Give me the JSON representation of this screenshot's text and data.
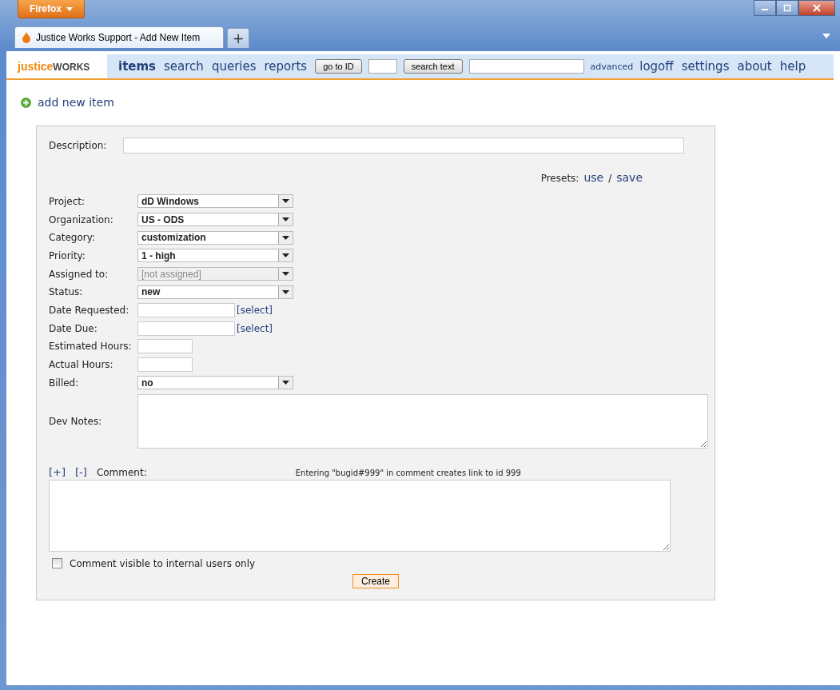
{
  "browser": {
    "menu_button": "Firefox",
    "tab_title": "Justice Works Support - Add New Item",
    "new_tab": "+"
  },
  "logo": {
    "part_1": "justice",
    "part_2": "WORKS"
  },
  "nav": {
    "links": [
      {
        "label": "items",
        "selected": true
      },
      {
        "label": "search",
        "selected": false
      },
      {
        "label": "queries",
        "selected": false
      },
      {
        "label": "reports",
        "selected": false
      }
    ],
    "go_button": "go to ID",
    "search_button": "search text",
    "advanced": "advanced",
    "right_links": [
      "logoff",
      "settings",
      "about",
      "help"
    ]
  },
  "add_new_item": "add new item",
  "form": {
    "description_label": "Description:",
    "presets_label": "Presets:",
    "presets_use": "use",
    "presets_sep": "/",
    "presets_save": "save",
    "fields": [
      {
        "kind": "select",
        "label": "Project:",
        "value": "dD Windows",
        "disabled": false
      },
      {
        "kind": "select",
        "label": "Organization:",
        "value": "US - ODS",
        "disabled": false
      },
      {
        "kind": "select",
        "label": "Category:",
        "value": "customization",
        "disabled": false
      },
      {
        "kind": "select",
        "label": "Priority:",
        "value": "1 - high",
        "disabled": false
      },
      {
        "kind": "select",
        "label": "Assigned to:",
        "value": "[not assigned]",
        "disabled": true
      },
      {
        "kind": "select",
        "label": "Status:",
        "value": "new",
        "disabled": false
      },
      {
        "kind": "date",
        "label": "Date Requested:",
        "link": "[select]"
      },
      {
        "kind": "date",
        "label": "Date Due:",
        "link": "[select]"
      },
      {
        "kind": "short",
        "label": "Estimated Hours:"
      },
      {
        "kind": "short",
        "label": "Actual Hours:"
      },
      {
        "kind": "select",
        "label": "Billed:",
        "value": "no",
        "disabled": false
      }
    ],
    "dev_notes_label": "Dev Notes:",
    "expand": "[+]",
    "collapse": "[-]",
    "comment_label": "Comment:",
    "comment_hint": "Entering \"bugid#999\" in comment creates link to id 999",
    "internal_only": {
      "label": "Comment visible to internal users only",
      "checked": false
    },
    "create_button": "Create"
  }
}
